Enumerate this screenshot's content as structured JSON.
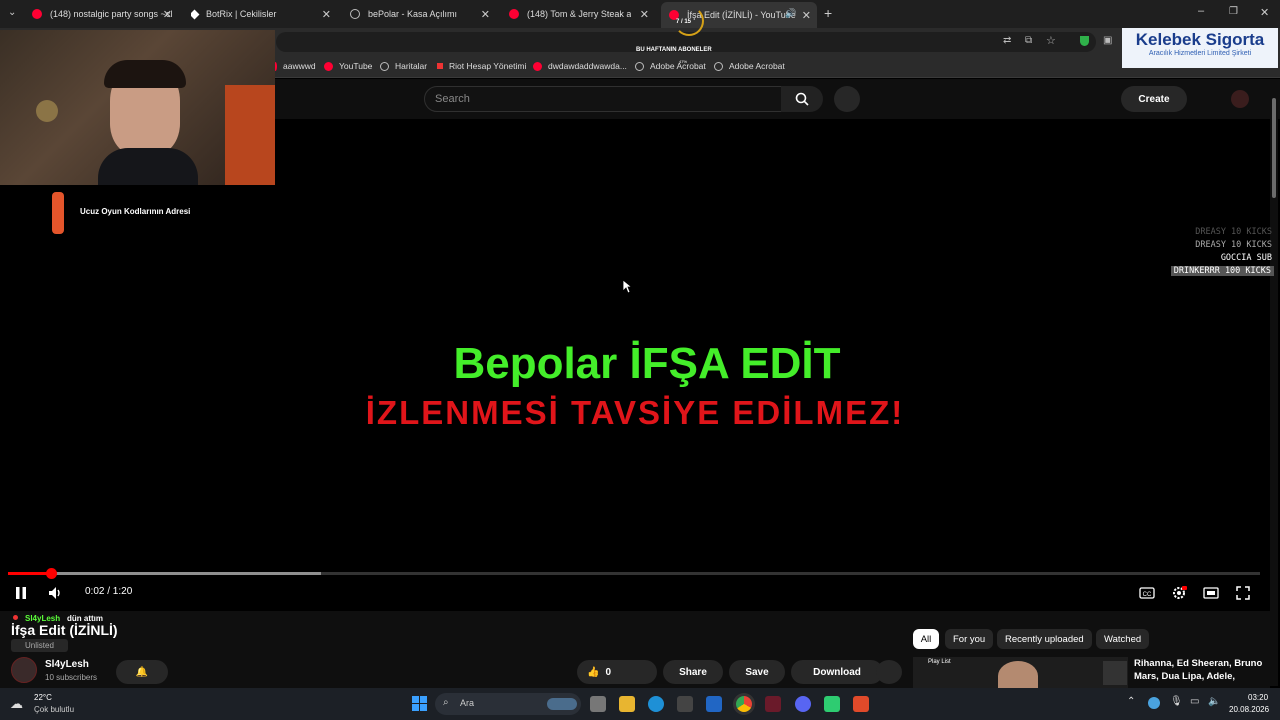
{
  "tabs": [
    {
      "label": "(148) nostalgic party songs ~cl",
      "icon": "youtube-icon"
    },
    {
      "label": "BotRix | Cekilisler",
      "icon": "botrix-icon"
    },
    {
      "label": "bePolar - Kasa Açılımı",
      "icon": "globe-icon"
    },
    {
      "label": "(148) Tom & Jerry Steak and a",
      "icon": "youtube-icon"
    },
    {
      "label": "İfşa Edit (İZİNLİ) - YouTube",
      "icon": "youtube-icon",
      "active": true
    }
  ],
  "bookmarks": [
    "aawwwd",
    "YouTube",
    "Haritalar",
    "Riot Hesap Yönetimi",
    "dwdawdaddwawda...",
    "Adobe Acrobat",
    "Adobe Acrobat"
  ],
  "overlay": {
    "subs_title": "BU HAFTANIN ABONELER",
    "subs_progress": "7 / 15",
    "subs_percent": "47%",
    "ad_link": "Ucuz Oyun Kodlarının Adresi",
    "sponsor_name": "Kelebek Sigorta",
    "sponsor_sub": "Aracılık Hizmetleri Limited Şirketi",
    "alerts": [
      "DREASY 10 KICKS",
      "DREASY 10 KICKS",
      "GOCCIA SUB",
      "DRINKERRR 100 KICKS"
    ]
  },
  "youtube_header": {
    "search_placeholder": "Search",
    "create_label": "Create"
  },
  "video": {
    "title_line1": "Bepolar İFŞA EDİT",
    "title_line2": "İZLENMESİ TAVSİYE EDİLMEZ!",
    "current_time": "0:02",
    "duration": "1:20",
    "time_display": "0:02 / 1:20",
    "played_fraction": 0.034,
    "buffered_fraction": 0.25,
    "colors": {
      "title_green": "#44ee2a",
      "title_red": "#e0151a",
      "progress": "#ff0000"
    }
  },
  "video_info": {
    "chat_user": "Sl4yLesh",
    "chat_msg": "dün attım",
    "title": "İfşa Edit (İZİNLİ)",
    "visibility": "Unlisted",
    "channel": "Sl4yLesh",
    "subscribers": "10 subscribers",
    "likes": "0",
    "share_label": "Share",
    "save_label": "Save",
    "download_label": "Download"
  },
  "filter_chips": [
    "All",
    "For you",
    "Recently uploaded",
    "Watched"
  ],
  "recommended": {
    "playlist_label": "Play List",
    "title": "Rihanna, Ed Sheeran, Bruno Mars, Dua Lipa, Adele,"
  },
  "taskbar": {
    "weather_temp": "22°C",
    "weather_desc": "Çok bulutlu",
    "search_label": "Ara",
    "time": "03:20",
    "date": "20.08.2026"
  }
}
